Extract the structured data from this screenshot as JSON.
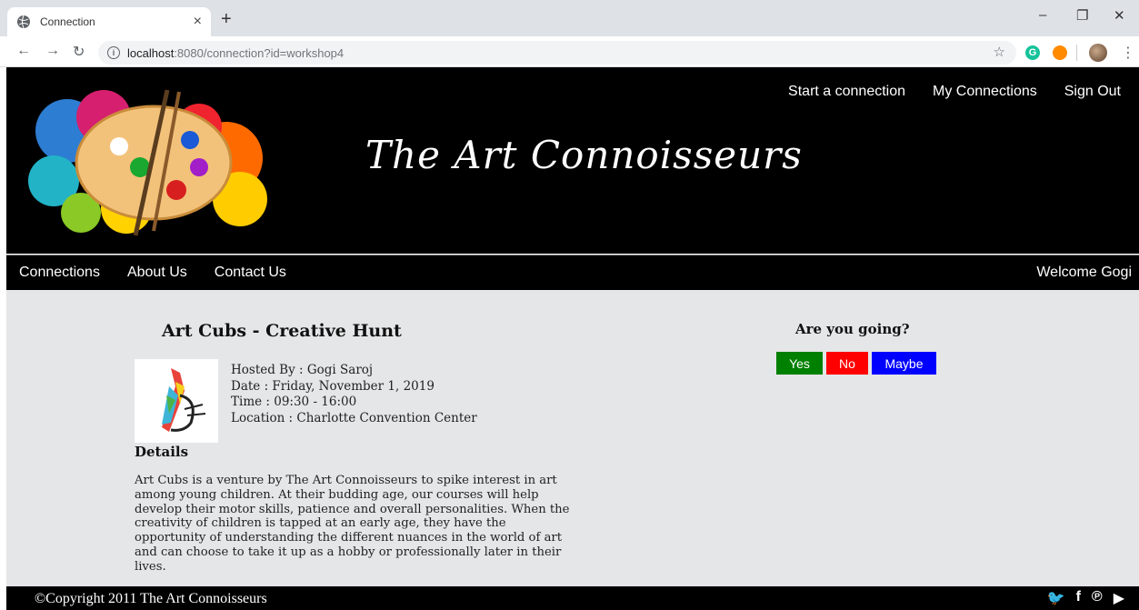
{
  "browser": {
    "tab_title": "Connection",
    "tab_close": "×",
    "new_tab": "+",
    "url_host": "localhost",
    "url_path": ":8080/connection?id=workshop4",
    "window_controls": [
      "–",
      "❐",
      "✕"
    ]
  },
  "header": {
    "brand": "The Art Connoisseurs",
    "top_nav": [
      "Start a connection",
      "My Connections",
      "Sign Out"
    ]
  },
  "subnav": {
    "items": [
      "Connections",
      "About Us",
      "Contact Us"
    ],
    "welcome": "Welcome Gogi"
  },
  "event": {
    "title": "Art Cubs - Creative Hunt",
    "hosted_by": "Hosted By : Gogi Saroj",
    "date": "Date : Friday, November 1, 2019",
    "time": "Time : 09:30 - 16:00",
    "location": "Location : Charlotte Convention Center",
    "details_heading": "Details",
    "details_text": "Art Cubs is a venture by The Art Connoisseurs to spike interest in art among young children. At their budding age, our courses will help develop their motor skills, patience and overall personalities. When the creativity of children is tapped at an early age, they have the opportunity of understanding the different nuances in the world of art and can choose to take it up as a hobby or professionally later in their lives."
  },
  "rsvp": {
    "question": "Are you going?",
    "yes": "Yes",
    "no": "No",
    "maybe": "Maybe",
    "colors": {
      "yes": "#008000",
      "no": "#ff0000",
      "maybe": "#0000ff"
    }
  },
  "footer": {
    "copyright": "©Copyright 2011 The Art Connoisseurs",
    "social_icons": [
      "twitter-icon",
      "facebook-icon",
      "pinterest-icon",
      "youtube-icon"
    ]
  }
}
